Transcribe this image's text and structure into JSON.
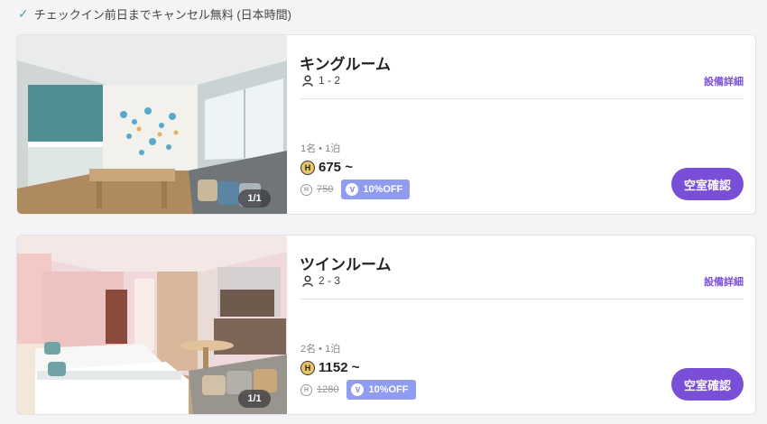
{
  "notice": {
    "text": "チェックイン前日までキャンセル無料 (日本時間)",
    "icon": "check-icon"
  },
  "rooms": [
    {
      "name": "キングルーム",
      "capacity": "1 - 2",
      "facility_link": "設備詳細",
      "photo_counter": "1/1",
      "plan": "1名 • 1泊",
      "currency_symbol": "H",
      "price": "675 ~",
      "original_price": "750",
      "discount_symbol": "V",
      "discount": "10%OFF",
      "button": "空室確認"
    },
    {
      "name": "ツインルーム",
      "capacity": "2 - 3",
      "facility_link": "設備詳細",
      "photo_counter": "1/1",
      "plan": "2名 • 1泊",
      "currency_symbol": "H",
      "price": "1152 ~",
      "original_price": "1280",
      "discount_symbol": "V",
      "discount": "10%OFF",
      "button": "空室確認"
    }
  ],
  "colors": {
    "accent": "#7a4fd8",
    "discount_badge": "#8f9cf0",
    "coin": "#e9c46a",
    "check": "#3fa8b5"
  }
}
